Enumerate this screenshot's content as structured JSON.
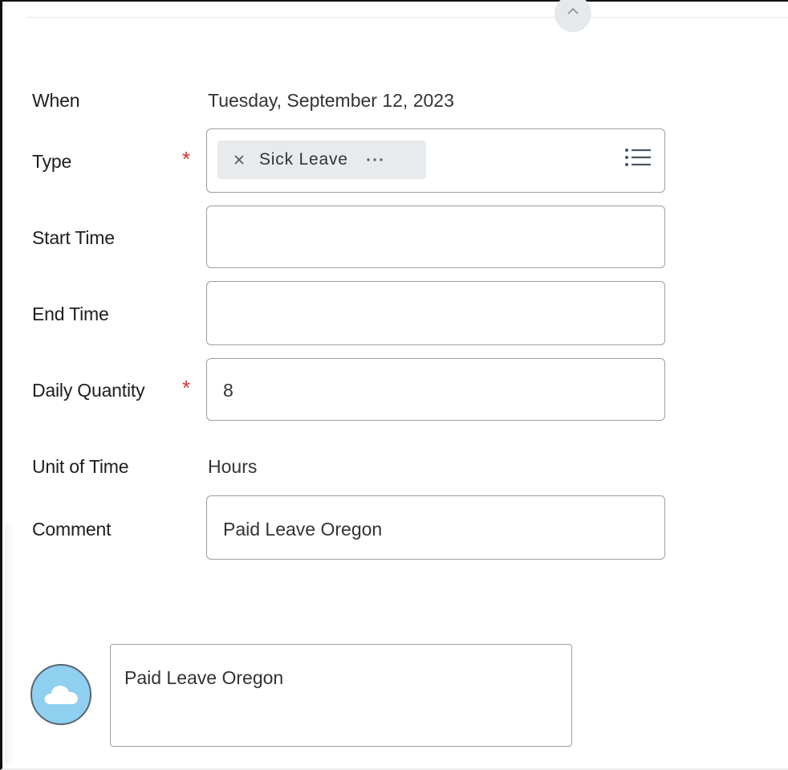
{
  "form": {
    "when": {
      "label": "When",
      "value": "Tuesday, September 12, 2023"
    },
    "type": {
      "label": "Type",
      "required_marker": "*",
      "chip_label": "Sick Leave"
    },
    "start_time": {
      "label": "Start Time",
      "value": ""
    },
    "end_time": {
      "label": "End Time",
      "value": ""
    },
    "daily_quantity": {
      "label": "Daily Quantity",
      "required_marker": "*",
      "value": "8"
    },
    "unit_of_time": {
      "label": "Unit of Time",
      "value": "Hours"
    },
    "comment": {
      "label": "Comment",
      "value": "Paid Leave Oregon"
    }
  },
  "comment_thread": {
    "avatar_icon": "cloud-icon",
    "text": "Paid Leave Oregon"
  },
  "colors": {
    "required": "#de2f2f",
    "avatar": "#8fcff0",
    "chip_bg": "#e8ebee",
    "field_border": "#9aa0a6"
  }
}
